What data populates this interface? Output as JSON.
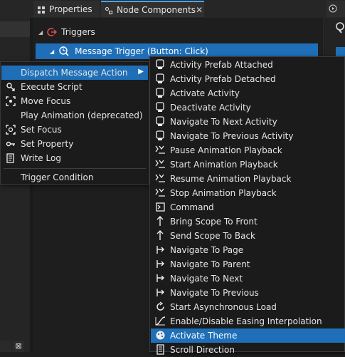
{
  "tabs": {
    "properties": "Properties",
    "node_components": "Node Components"
  },
  "panel": {
    "triggers_label": "Triggers",
    "message_trigger": "Message Trigger (Button: Click)"
  },
  "action_menu": {
    "items": [
      {
        "label": "Dispatch Message Action",
        "icon": "none",
        "has_submenu": true
      },
      {
        "label": "Execute Script",
        "icon": "script-icon"
      },
      {
        "label": "Move Focus",
        "icon": "move-focus-icon"
      },
      {
        "label": "Play Animation (deprecated)",
        "icon": "none"
      },
      {
        "label": "Set Focus",
        "icon": "set-focus-icon"
      },
      {
        "label": "Set Property",
        "icon": "set-property-icon"
      },
      {
        "label": "Write Log",
        "icon": "write-log-icon"
      }
    ],
    "trigger_condition": "Trigger Condition"
  },
  "submenu": {
    "items": [
      {
        "label": "Activity Prefab Attached",
        "icon": "activity-icon"
      },
      {
        "label": "Activity Prefab Detached",
        "icon": "activity-icon"
      },
      {
        "label": "Activate Activity",
        "icon": "activity-icon"
      },
      {
        "label": "Deactivate Activity",
        "icon": "activity-icon"
      },
      {
        "label": "Navigate To Next Activity",
        "icon": "activity-icon"
      },
      {
        "label": "Navigate To Previous Activity",
        "icon": "activity-icon"
      },
      {
        "label": "Pause Animation Playback",
        "icon": "animation-icon"
      },
      {
        "label": "Start Animation Playback",
        "icon": "animation-icon"
      },
      {
        "label": "Resume Animation Playback",
        "icon": "animation-icon"
      },
      {
        "label": "Stop Animation Playback",
        "icon": "animation-icon"
      },
      {
        "label": "Command",
        "icon": "command-icon"
      },
      {
        "label": "Bring Scope To Front",
        "icon": "scope-icon"
      },
      {
        "label": "Send Scope To Back",
        "icon": "scope-icon"
      },
      {
        "label": "Navigate To Page",
        "icon": "navigate-icon"
      },
      {
        "label": "Navigate To Parent",
        "icon": "navigate-icon"
      },
      {
        "label": "Navigate To Next",
        "icon": "navigate-icon"
      },
      {
        "label": "Navigate To Previous",
        "icon": "navigate-icon"
      },
      {
        "label": "Start Asynchronous Load",
        "icon": "async-load-icon"
      },
      {
        "label": "Enable/Disable Easing Interpolation",
        "icon": "easing-icon"
      },
      {
        "label": "Activate Theme",
        "icon": "theme-icon",
        "selected": true
      },
      {
        "label": "Scroll Direction",
        "icon": "scroll-icon"
      }
    ]
  },
  "colors": {
    "accent": "#1f6fb8",
    "menu_bg": "#1b1b1b",
    "panel_bg": "#1e1e1e"
  }
}
